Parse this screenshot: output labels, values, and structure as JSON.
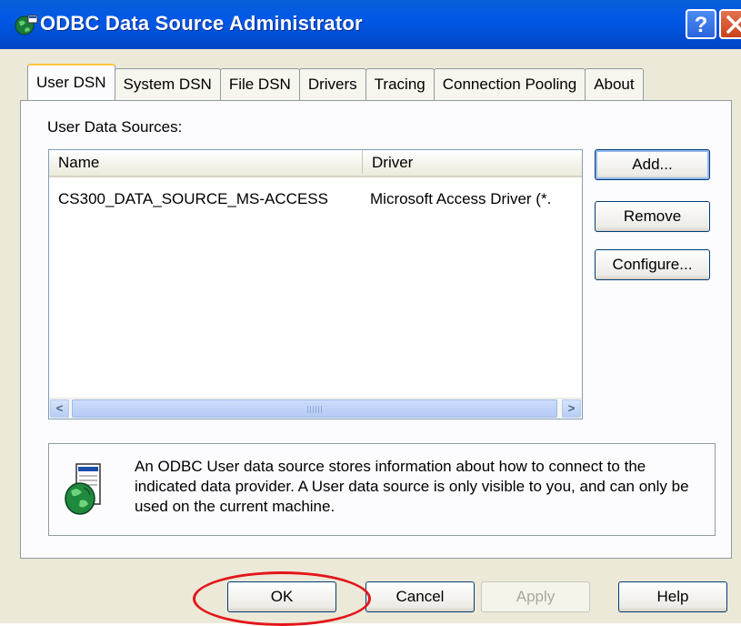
{
  "window": {
    "title": "ODBC Data Source Administrator",
    "help_glyph": "?",
    "app_icon": "odbc-globe-icon"
  },
  "tabs": [
    {
      "label": "User DSN",
      "active": true
    },
    {
      "label": "System DSN",
      "active": false
    },
    {
      "label": "File DSN",
      "active": false
    },
    {
      "label": "Drivers",
      "active": false
    },
    {
      "label": "Tracing",
      "active": false
    },
    {
      "label": "Connection Pooling",
      "active": false
    },
    {
      "label": "About",
      "active": false
    }
  ],
  "user_dsn": {
    "section_label": "User Data Sources:",
    "columns": [
      "Name",
      "Driver"
    ],
    "rows": [
      {
        "name": "CS300_DATA_SOURCE_MS-ACCESS",
        "driver": "Microsoft Access Driver (*."
      }
    ],
    "scrollbar": {
      "left_arrow": "<",
      "right_arrow": ">",
      "grip": "|||"
    },
    "buttons": {
      "add": "Add...",
      "remove": "Remove",
      "configure": "Configure..."
    },
    "info": {
      "icon": "database-globe-icon",
      "text": "An ODBC User data source stores information about how to connect to the indicated data provider.  A User data source is only visible to you, and can only be used on the current machine."
    }
  },
  "footer": {
    "ok": "OK",
    "cancel": "Cancel",
    "apply": "Apply",
    "help": "Help",
    "highlight_color": "#e3161b"
  },
  "colors": {
    "titlebar": "#0058e6",
    "dialog_bg": "#ece9d8",
    "active_tab_accent": "#ffc83c"
  }
}
